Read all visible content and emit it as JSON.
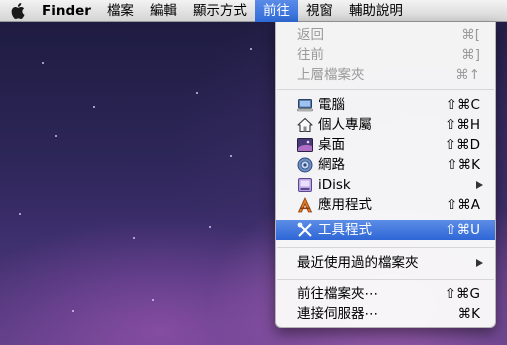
{
  "menubar": {
    "apple": "",
    "app_name": "Finder",
    "menus": [
      "檔案",
      "編輯",
      "顯示方式",
      "前往",
      "視窗",
      "輔助說明"
    ]
  },
  "go_menu": {
    "history": [
      {
        "label": "返回",
        "shortcut": "⌘["
      },
      {
        "label": "往前",
        "shortcut": "⌘]"
      },
      {
        "label": "上層檔案夾",
        "shortcut": "⌘↑"
      }
    ],
    "places": [
      {
        "label": "電腦",
        "shortcut": "⇧⌘C",
        "icon": "computer-icon"
      },
      {
        "label": "個人專屬",
        "shortcut": "⇧⌘H",
        "icon": "home-icon"
      },
      {
        "label": "桌面",
        "shortcut": "⇧⌘D",
        "icon": "desktop-icon"
      },
      {
        "label": "網路",
        "shortcut": "⇧⌘K",
        "icon": "network-icon"
      },
      {
        "label": "iDisk",
        "shortcut": "",
        "icon": "idisk-icon"
      },
      {
        "label": "應用程式",
        "shortcut": "⇧⌘A",
        "icon": "applications-icon"
      },
      {
        "label": "工具程式",
        "shortcut": "⇧⌘U",
        "icon": "utilities-icon"
      }
    ],
    "recent": {
      "label": "最近使用過的檔案夾"
    },
    "goto": [
      {
        "label": "前往檔案夾⋯",
        "shortcut": "⇧⌘G"
      },
      {
        "label": "連接伺服器⋯",
        "shortcut": "⌘K"
      }
    ]
  },
  "colors": {
    "selection": "#3a72dc",
    "disabled_text": "#9a9a9a"
  }
}
